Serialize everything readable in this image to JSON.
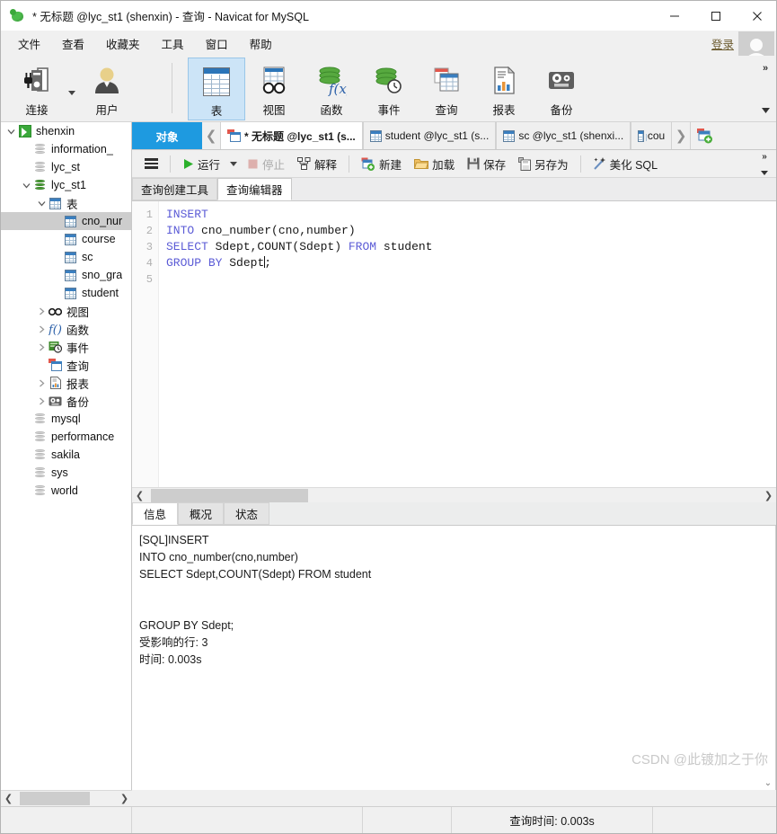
{
  "window": {
    "title": "* 无标题 @lyc_st1 (shenxin) - 查询 - Navicat for MySQL",
    "minimize": "−",
    "maximize": "□",
    "close": "✕"
  },
  "menubar": {
    "items": [
      "文件",
      "查看",
      "收藏夹",
      "工具",
      "窗口",
      "帮助"
    ],
    "login": "登录"
  },
  "ribbon": {
    "buttons": [
      {
        "label": "连接",
        "icon": "connection-icon"
      },
      {
        "label": "用户",
        "icon": "user-icon"
      },
      {
        "label": "表",
        "icon": "table-icon",
        "active": true
      },
      {
        "label": "视图",
        "icon": "view-icon"
      },
      {
        "label": "函数",
        "icon": "function-icon"
      },
      {
        "label": "事件",
        "icon": "event-icon"
      },
      {
        "label": "查询",
        "icon": "query-icon"
      },
      {
        "label": "报表",
        "icon": "report-icon"
      },
      {
        "label": "备份",
        "icon": "backup-icon"
      }
    ],
    "overflow": "»"
  },
  "tree": {
    "items": [
      {
        "label": "shenxin",
        "indent": 0,
        "arrow": "down",
        "icon": "connection-green-icon",
        "selected": false
      },
      {
        "label": "information_",
        "indent": 1,
        "arrow": "none",
        "icon": "database-grey-icon",
        "selected": false
      },
      {
        "label": "lyc_st",
        "indent": 1,
        "arrow": "none",
        "icon": "database-grey-icon",
        "selected": false
      },
      {
        "label": "lyc_st1",
        "indent": 1,
        "arrow": "down",
        "icon": "database-green-icon",
        "selected": false
      },
      {
        "label": "表",
        "indent": 2,
        "arrow": "down",
        "icon": "table-folder-icon",
        "selected": false
      },
      {
        "label": "cno_nur",
        "indent": 3,
        "arrow": "none",
        "icon": "table-icon",
        "selected": true
      },
      {
        "label": "course",
        "indent": 3,
        "arrow": "none",
        "icon": "table-icon",
        "selected": false
      },
      {
        "label": "sc",
        "indent": 3,
        "arrow": "none",
        "icon": "table-icon",
        "selected": false
      },
      {
        "label": "sno_gra",
        "indent": 3,
        "arrow": "none",
        "icon": "table-icon",
        "selected": false
      },
      {
        "label": "student",
        "indent": 3,
        "arrow": "none",
        "icon": "table-icon",
        "selected": false
      },
      {
        "label": "视图",
        "indent": 2,
        "arrow": "right",
        "icon": "view-icon",
        "selected": false
      },
      {
        "label": "函数",
        "indent": 2,
        "arrow": "right",
        "icon": "function-icon",
        "selected": false
      },
      {
        "label": "事件",
        "indent": 2,
        "arrow": "right",
        "icon": "event-icon",
        "selected": false
      },
      {
        "label": "查询",
        "indent": 2,
        "arrow": "none",
        "icon": "query-icon",
        "selected": false
      },
      {
        "label": "报表",
        "indent": 2,
        "arrow": "right",
        "icon": "report-icon",
        "selected": false
      },
      {
        "label": "备份",
        "indent": 2,
        "arrow": "right",
        "icon": "backup-icon",
        "selected": false
      },
      {
        "label": "mysql",
        "indent": 1,
        "arrow": "none",
        "icon": "database-grey-icon",
        "selected": false
      },
      {
        "label": "performance",
        "indent": 1,
        "arrow": "none",
        "icon": "database-grey-icon",
        "selected": false
      },
      {
        "label": "sakila",
        "indent": 1,
        "arrow": "none",
        "icon": "database-grey-icon",
        "selected": false
      },
      {
        "label": "sys",
        "indent": 1,
        "arrow": "none",
        "icon": "database-grey-icon",
        "selected": false
      },
      {
        "label": "world",
        "indent": 1,
        "arrow": "none",
        "icon": "database-grey-icon",
        "selected": false
      }
    ]
  },
  "doctabs": {
    "object_tab": "对象",
    "prev_arrow": "❮",
    "next_arrow": "❯",
    "tabs": [
      {
        "label": "* 无标题 @lyc_st1 (s...",
        "icon": "query-icon",
        "active": true
      },
      {
        "label": "student @lyc_st1 (s...",
        "icon": "table-icon",
        "active": false
      },
      {
        "label": "sc @lyc_st1 (shenxi...",
        "icon": "table-icon",
        "active": false
      },
      {
        "label": "cou",
        "icon": "table-icon",
        "active": false
      }
    ],
    "new_tab": "new-tab-icon"
  },
  "query_toolbar": {
    "menu": "hamburger-icon",
    "run": "运行",
    "run_caret": "▾",
    "stop": "停止",
    "explain": "解释",
    "new": "新建",
    "load": "加载",
    "save": "保存",
    "save_as": "另存为",
    "beautify": "美化 SQL",
    "overflow": "»"
  },
  "editor_tabs": [
    {
      "label": "查询创建工具",
      "active": false
    },
    {
      "label": "查询编辑器",
      "active": true
    }
  ],
  "editor": {
    "line_numbers": [
      "1",
      "2",
      "3",
      "4",
      "5"
    ],
    "lines": [
      [
        {
          "t": "INSERT",
          "kw": true
        }
      ],
      [
        {
          "t": "INTO",
          "kw": true
        },
        {
          "t": " cno_number(cno,number)",
          "kw": false
        }
      ],
      [
        {
          "t": "SELECT",
          "kw": true
        },
        {
          "t": " Sdept,COUNT(Sdept) ",
          "kw": false
        },
        {
          "t": "FROM",
          "kw": true
        },
        {
          "t": " student",
          "kw": false
        }
      ],
      [
        {
          "t": "GROUP",
          "kw": true
        },
        {
          "t": " ",
          "kw": false
        },
        {
          "t": "BY",
          "kw": true
        },
        {
          "t": " Sdept",
          "kw": false
        },
        {
          "t": "|CURSOR|",
          "kw": false
        },
        {
          "t": ";",
          "kw": false
        }
      ],
      [
        {
          "t": "",
          "kw": false
        }
      ]
    ]
  },
  "result_tabs": [
    {
      "label": "信息",
      "active": true
    },
    {
      "label": "概况",
      "active": false
    },
    {
      "label": "状态",
      "active": false
    }
  ],
  "result_log": "[SQL]INSERT\nINTO cno_number(cno,number)\nSELECT Sdept,COUNT(Sdept) FROM student\n\n\nGROUP BY Sdept;\n受影响的行: 3\n时间: 0.003s",
  "watermark": "CSDN @此镀加之于你",
  "statusbar": {
    "query_time": "查询时间: 0.003s"
  },
  "colors": {
    "accent_blue": "#1e9ae0",
    "ribbon_active": "#cce4f7",
    "keyword": "#5b5bd6",
    "selection_grey": "#cdcdcd",
    "green": "#4fa33a"
  }
}
